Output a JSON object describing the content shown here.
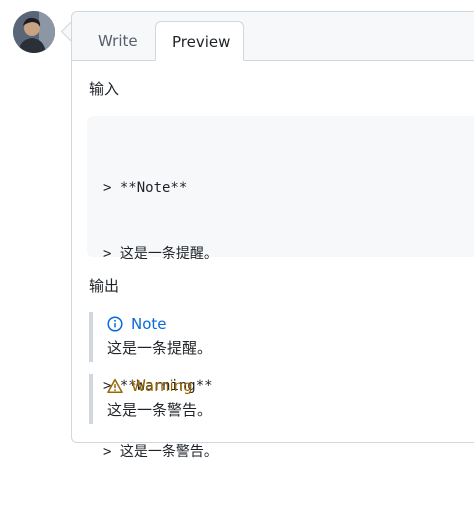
{
  "tabs": {
    "write_label": "Write",
    "preview_label": "Preview"
  },
  "preview": {
    "input_heading": "输入",
    "code_lines": [
      "> **Note**",
      "> 这是一条提醒。",
      "",
      "> **Warning**",
      "> 这是一条警告。"
    ],
    "output_heading": "输出",
    "note_alert": {
      "title": "Note",
      "body": "这是一条提醒。",
      "icon": "info-icon",
      "color": "#0969da"
    },
    "warning_alert": {
      "title": "Warning",
      "body": "这是一条警告。",
      "icon": "warning-icon",
      "color": "#9a6700"
    }
  },
  "colors": {
    "border": "#d0d7de",
    "header_bg": "#f6f8fa",
    "code_bg": "#f6f8fa"
  }
}
